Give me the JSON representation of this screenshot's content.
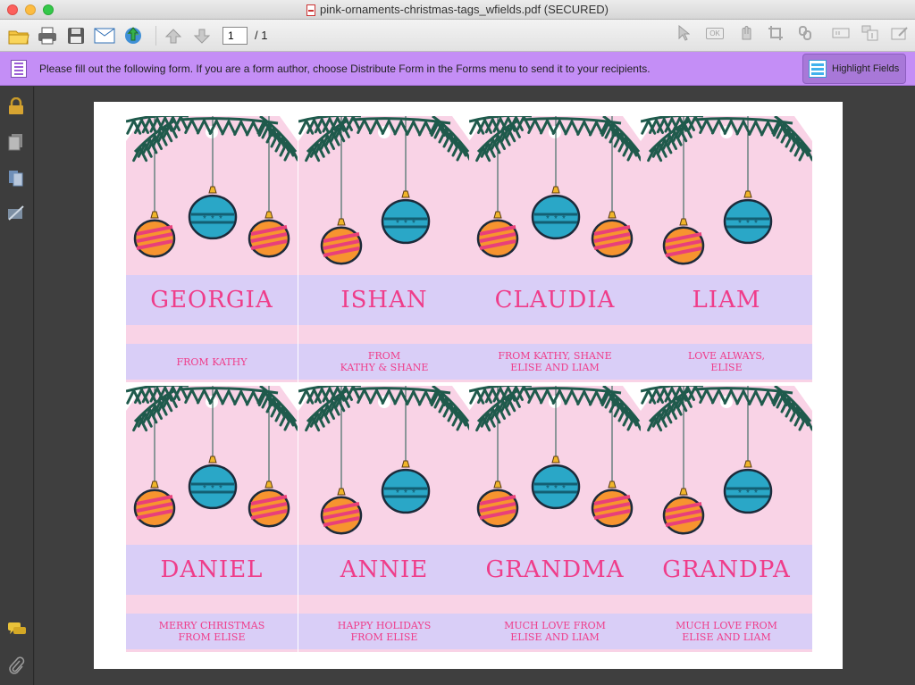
{
  "window": {
    "title": "pink-ornaments-christmas-tags_wfields.pdf (SECURED)"
  },
  "toolbar": {
    "current_page": "1",
    "page_total": "/ 1",
    "ok_label": "OK"
  },
  "form_bar": {
    "message": "Please fill out the following form. If you are a form author, choose Distribute Form in the Forms menu to send it to your recipients.",
    "highlight_label": "Highlight Fields"
  },
  "colors": {
    "form_bar": "#c48ef6",
    "tag_pink": "#f9d3e6",
    "band_lavender": "#d9cef7",
    "text_pink": "#ef3d8a",
    "pine": "#1f5a4c",
    "ornament_teal": "#2aa7c7",
    "ornament_orange": "#f7942f",
    "ornament_stripe": "#e8407a",
    "ornament_cap": "#f0b52a"
  },
  "tags": [
    {
      "name": "GEORGIA",
      "message": "FROM KATHY"
    },
    {
      "name": "ISHAN",
      "message": "FROM\nKATHY & SHANE"
    },
    {
      "name": "CLAUDIA",
      "message": "FROM KATHY, SHANE\nELISE AND LIAM"
    },
    {
      "name": "LIAM",
      "message": "LOVE ALWAYS,\nELISE"
    },
    {
      "name": "DANIEL",
      "message": "MERRY CHRISTMAS\nFROM ELISE"
    },
    {
      "name": "ANNIE",
      "message": "HAPPY HOLIDAYS\nFROM ELISE"
    },
    {
      "name": "GRANDMA",
      "message": "MUCH LOVE FROM\nELISE AND LIAM"
    },
    {
      "name": "GRANDPA",
      "message": "MUCH LOVE FROM\nELISE AND LIAM"
    }
  ]
}
